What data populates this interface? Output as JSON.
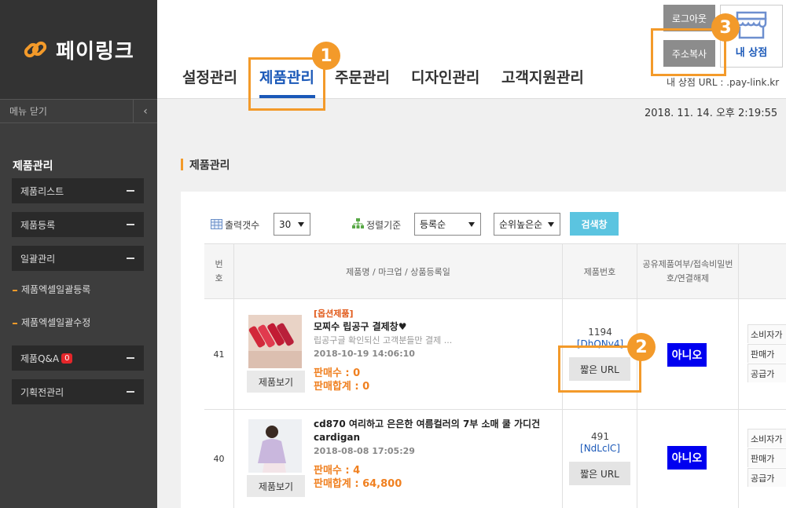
{
  "sidebar": {
    "logo_text": "페이링크",
    "menu_close": "메뉴 닫기",
    "section_title": "제품관리",
    "items": [
      {
        "label": "제품리스트"
      },
      {
        "label": "제품등록"
      },
      {
        "label": "일괄관리"
      },
      {
        "label": "제품Q&A",
        "badge": "0"
      },
      {
        "label": "기획전관리"
      }
    ],
    "subitems": [
      {
        "label": "제품엑셀일괄등록"
      },
      {
        "label": "제품엑셀일괄수정"
      }
    ]
  },
  "header": {
    "tabs": [
      {
        "label": "설정관리"
      },
      {
        "label": "제품관리",
        "active": true
      },
      {
        "label": "주문관리"
      },
      {
        "label": "디자인관리"
      },
      {
        "label": "고객지원관리"
      }
    ],
    "logout_label": "로그아웃",
    "copy_address_label": "주소복사",
    "myshop_label": "내 상점",
    "shop_url": "내 상점 URL : .pay-link.kr"
  },
  "annotations": [
    "1",
    "2",
    "3"
  ],
  "datetime": "2018. 11. 14. 오후 2:19:55",
  "main": {
    "section_title": "제품관리",
    "filters": {
      "count_label": "출력갯수",
      "count_value": "30",
      "sort_label": "정렬기준",
      "sort_value": "등록순",
      "order_value": "순위높은순",
      "search_label": "검색창"
    },
    "table": {
      "headers": {
        "num": "번호",
        "product": "제품명 / 마크업 / 상품등록일",
        "prod_no": "제품번호",
        "share": "공유제품여부/접속비밀번호/연결해제"
      },
      "rows": [
        {
          "num": "41",
          "option_tag": "[옵션제품]",
          "name": "모찌수 립공구 결제창♥",
          "desc": "립공구글 확인되신 고객분들만 결제 ...",
          "date": "2018-10-19 14:06:10",
          "sales": "판매수 : 0",
          "sales_total": "판매합계 : 0",
          "prod_no": "1194",
          "prod_code": "[DhQNv4]",
          "short_url": "짧은 URL",
          "share": "아니오",
          "view": "제품보기",
          "price_labels": [
            "소비자가",
            "판매가",
            "공급가"
          ]
        },
        {
          "num": "40",
          "name": "cd870 여리하고 은은한 여름컬러의 7부 소매 쿨 가디건",
          "name2": "cardigan",
          "date": "2018-08-08 17:05:29",
          "sales": "판매수 : 4",
          "sales_total": "판매합계 : 64,800",
          "prod_no": "491",
          "prod_code": "[NdLclC]",
          "short_url": "짧은 URL",
          "share": "아니오",
          "view": "제품보기",
          "price_labels": [
            "소비자가",
            "판매가",
            "공급가"
          ]
        }
      ]
    }
  },
  "colors": {
    "accent": "#f39a2a",
    "tab_active": "#1a58b8",
    "sidebar_bg": "#3d3d3d",
    "search_btn": "#5bc4e0",
    "no_badge": "#0000f0"
  }
}
